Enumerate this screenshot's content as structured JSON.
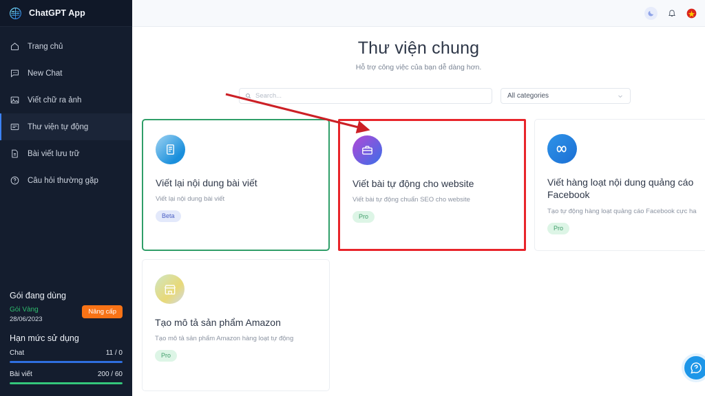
{
  "sidebar": {
    "brand": {
      "name": "ChatGPT App",
      "logo_icon": "brain-network-icon"
    },
    "items": [
      {
        "label": "Trang chủ",
        "icon": "home-icon",
        "active": false
      },
      {
        "label": "New Chat",
        "icon": "chat-bubble-icon",
        "active": false
      },
      {
        "label": "Viết chữ ra ảnh",
        "icon": "image-icon",
        "active": false
      },
      {
        "label": "Thư viện tự động",
        "icon": "article-list-icon",
        "active": true
      },
      {
        "label": "Bài viết lưu trữ",
        "icon": "file-icon",
        "active": false
      },
      {
        "label": "Câu hỏi thường gặp",
        "icon": "question-circle-icon",
        "active": false
      }
    ],
    "plan": {
      "heading": "Gói đang dùng",
      "name": "Gói Vàng",
      "date": "28/06/2023",
      "upgrade_label": "Nâng cấp",
      "name_color": "#2fbd6f",
      "upgrade_color": "#f97316"
    },
    "quota": {
      "heading": "Hạn mức sử dụng",
      "items": [
        {
          "label": "Chat",
          "value": "11 / 0",
          "percent": 100,
          "color": "#2f6fe0"
        },
        {
          "label": "Bài viết",
          "value": "200 / 60",
          "percent": 100,
          "color": "#34c77b"
        }
      ]
    }
  },
  "topbar": {
    "icons": [
      {
        "name": "dark-mode-moon-icon"
      },
      {
        "name": "notification-bell-icon"
      },
      {
        "name": "vietnam-flag-icon"
      }
    ]
  },
  "header": {
    "title": "Thư viện chung",
    "subtitle": "Hỗ trợ công việc của bạn dễ dàng hơn."
  },
  "filters": {
    "search": {
      "placeholder": "Search...",
      "value": "",
      "icon": "search-icon"
    },
    "category": {
      "selected": "All categories",
      "icon": "chevron-down-icon"
    }
  },
  "cards": [
    {
      "title": "Viết lại nội dung bài viết",
      "desc": "Viết lại nội dung bài viết",
      "badge": "Beta",
      "badge_type": "beta",
      "icon": "document-rewrite-icon",
      "highlight": "green"
    },
    {
      "title": "Viết bài tự động cho website",
      "desc": "Viết bài tự động chuẩn SEO cho website",
      "badge": "Pro",
      "badge_type": "pro",
      "icon": "briefcase-icon",
      "highlight": "red"
    },
    {
      "title": "Viết hàng loạt nội dung quảng cáo Facebook",
      "desc": "Tạo tự động hàng loạt quảng cáo Facebook cực ha",
      "badge": "Pro",
      "badge_type": "pro",
      "icon": "meta-infinity-icon",
      "highlight": "none"
    },
    {
      "title": "Tạo mô tả sản phẩm Amazon",
      "desc": "Tạo mô tả sản phẩm Amazon hàng loạt tự động",
      "badge": "Pro",
      "badge_type": "pro",
      "icon": "storefront-icon",
      "highlight": "none"
    }
  ],
  "fab": {
    "icon": "support-chat-icon",
    "color": "#1d96e8"
  },
  "annotation": {
    "arrow_color": "#cc2026",
    "highlight_box_color": "#e8242a"
  }
}
